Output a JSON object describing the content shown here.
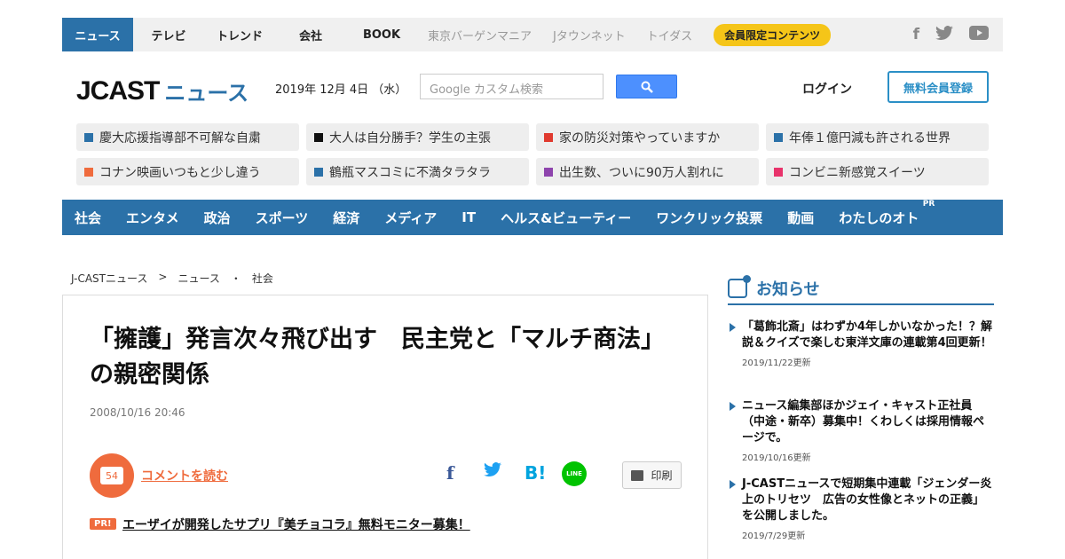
{
  "topnav": {
    "items": [
      "ニュース",
      "テレビ",
      "トレンド",
      "会社",
      "BOOK"
    ],
    "grey_items": [
      "東京バーゲンマニア",
      "Jタウンネット",
      "トイダス"
    ],
    "member_badge": "会員限定コンテンツ",
    "socials": [
      "facebook-icon",
      "twitter-icon",
      "youtube-icon"
    ]
  },
  "header": {
    "logo_main": "JCAST",
    "logo_sub": "ニュース",
    "date": "2019年 12月 4日 （水）",
    "search_placeholder": "Google カスタム検索",
    "login": "ログイン",
    "register": "無料会員登録"
  },
  "topics": [
    {
      "label": "慶大応援指導部不可解な自粛",
      "color": "#2b71a8"
    },
    {
      "label": "大人は自分勝手？学生の主張",
      "color": "#111111"
    },
    {
      "label": "家の防災対策やっていますか",
      "color": "#e03a2f"
    },
    {
      "label": "年俸１億円減も許される世界",
      "color": "#2b71a8"
    },
    {
      "label": "コナン映画いつもと少し違う",
      "color": "#ef6b3d"
    },
    {
      "label": "鶴瓶マスコミに不満タラタラ",
      "color": "#2b71a8"
    },
    {
      "label": "出生数、ついに90万人割れに",
      "color": "#8e44ad"
    },
    {
      "label": "コンビニ新感覚スイーツ",
      "color": "#e8336b"
    }
  ],
  "categories": [
    "社会",
    "エンタメ",
    "政治",
    "スポーツ",
    "経済",
    "メディア",
    "IT",
    "ヘルス&ビューティー",
    "ワンクリック投票",
    "動画",
    "わたしのオト"
  ],
  "category_pr": "PR",
  "breadcrumb": [
    "J-CASTニュース",
    ">",
    "ニュース",
    "・",
    "社会"
  ],
  "article": {
    "title": "「擁護」発言次々飛び出す　民主党と「マルチ商法」の親密関係",
    "date": "2008/10/16 20:46",
    "comment_count": "54",
    "comment_link": "コメントを読む",
    "share": {
      "fb": "f",
      "hb": "B!",
      "line": "LINE"
    },
    "print": "印刷",
    "pr_badge": "PR!",
    "pr_text": "エーザイが開発したサプリ『美チョコラ』無料モニター募集！"
  },
  "sidebar": {
    "title": "お知らせ",
    "notices": [
      {
        "text": "「葛飾北斎」はわずか4年しかいなかった！？解説＆クイズで楽しむ東洋文庫の連載第4回更新！",
        "date": "2019/11/22更新"
      },
      {
        "text": "ニュース編集部ほかジェイ・キャスト正社員（中途・新卒）募集中！くわしくは採用情報ページで。",
        "date": "2019/10/16更新"
      },
      {
        "text": "J-CASTニュースで短期集中連載「ジェンダー炎上のトリセツ　広告の女性像とネットの正義」を公開しました。",
        "date": "2019/7/29更新"
      }
    ]
  }
}
